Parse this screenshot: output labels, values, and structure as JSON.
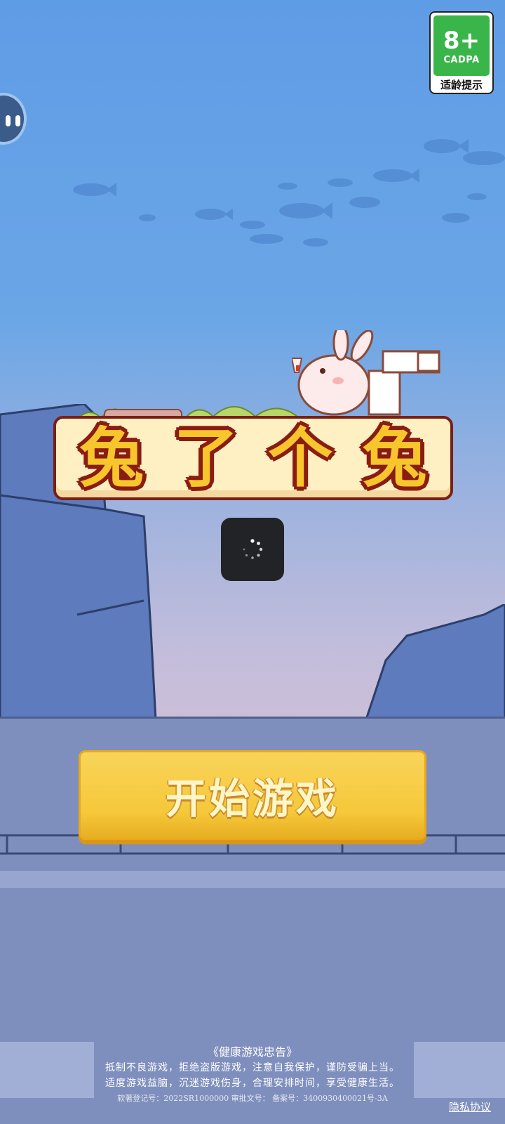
{
  "age_badge": {
    "age": "8+",
    "org": "CADPA",
    "tip": "适龄提示"
  },
  "title_chars": [
    "兔",
    "了",
    "个",
    "兔"
  ],
  "start_button": {
    "label": "开始游戏"
  },
  "notice": {
    "title": "《健康游戏忠告》",
    "line1": "抵制不良游戏，拒绝盗版游戏，注意自我保护，谨防受骗上当。",
    "line2": "适度游戏益脑，沉迷游戏伤身，合理安排时间，享受健康生活。",
    "registration": "软著登记号：2022SR1000000    审批文号：    备案号：3400930400021号-3A"
  },
  "privacy_link": "隐私协议",
  "icons": {
    "float_ball": "assistant-ball-icon",
    "loader": "loading-spinner-icon"
  },
  "colors": {
    "button": "#f6c83a",
    "title_fill": "#f7c52c",
    "title_outline": "#8a1d12",
    "badge_green": "#39b54a"
  }
}
